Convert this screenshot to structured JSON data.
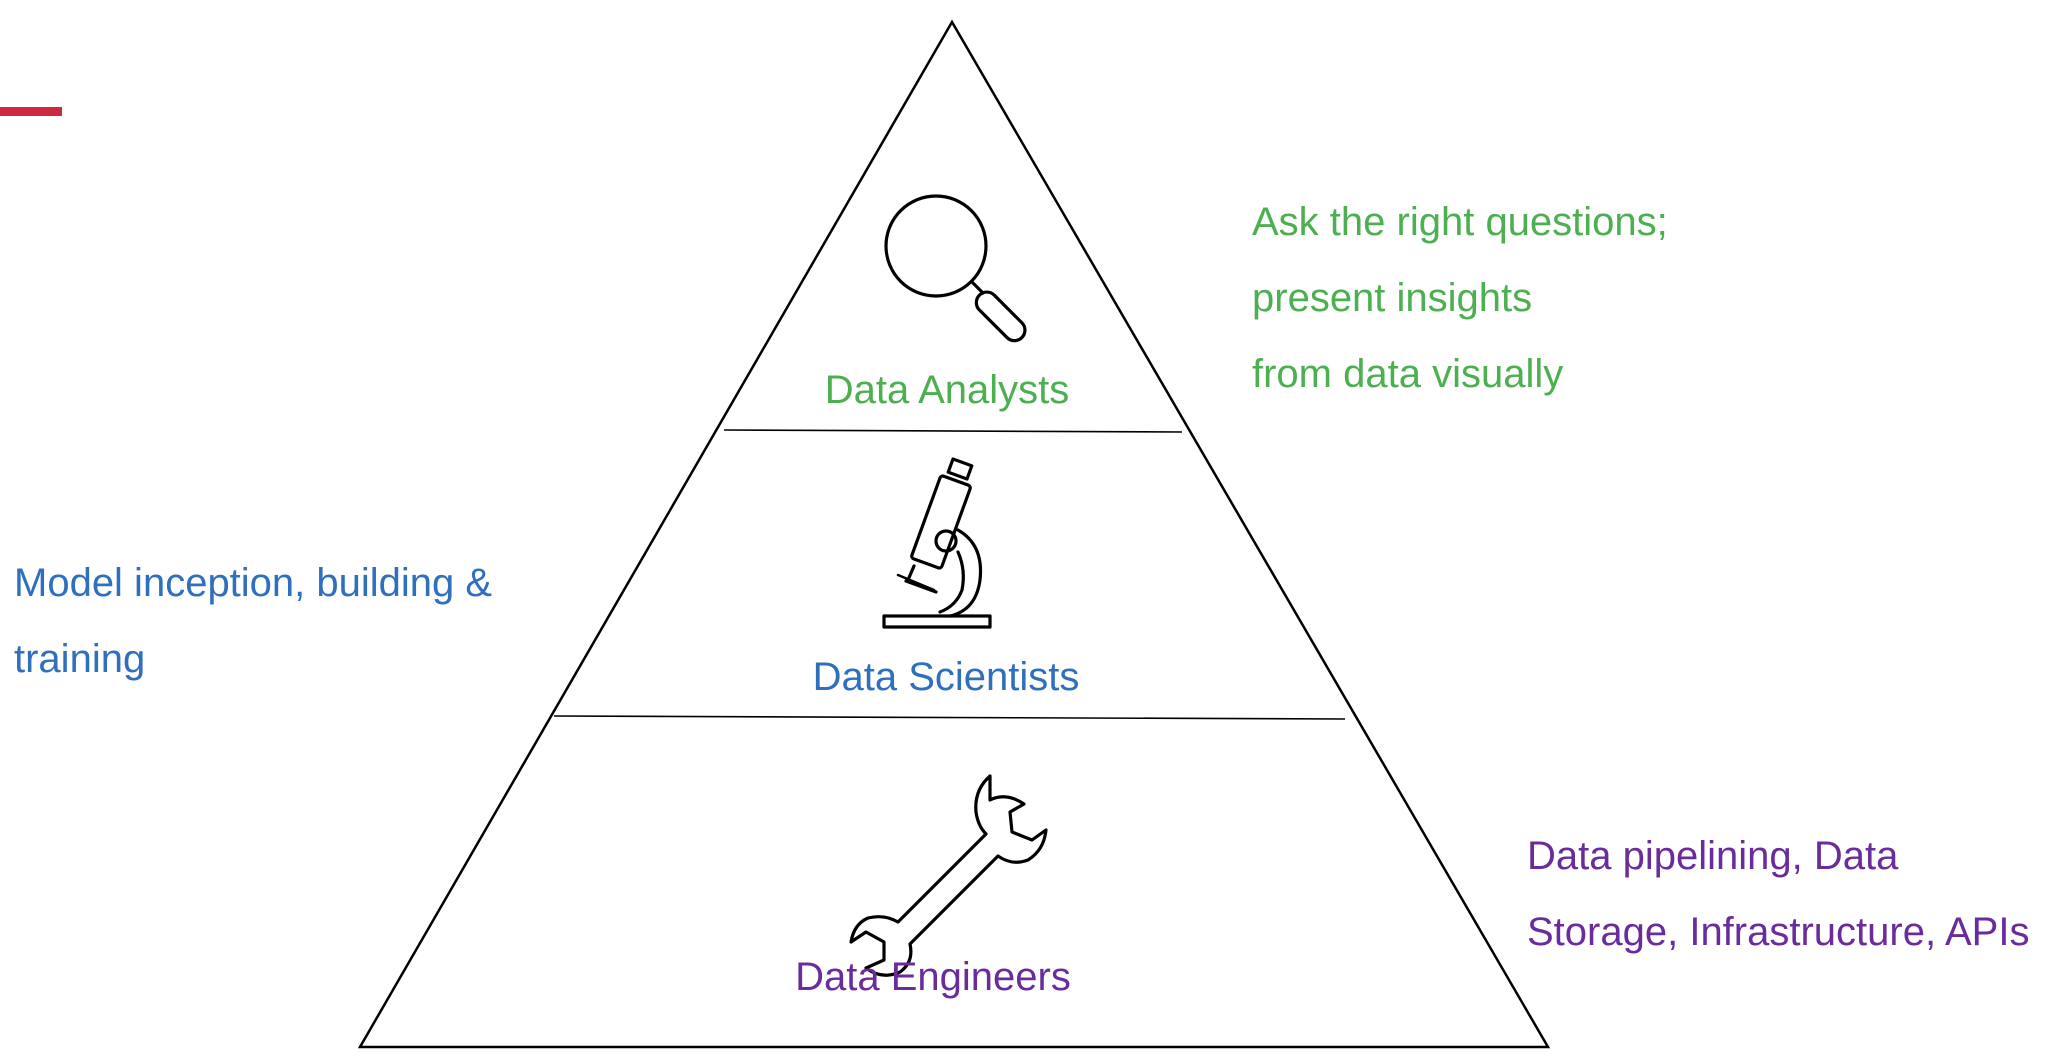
{
  "colors": {
    "accent_bar": "#d0293f",
    "analysts": "#4caf50",
    "scientists": "#2e6fbe",
    "engineers": "#6a2c9c",
    "outline": "#000000"
  },
  "pyramid": {
    "tiers": [
      {
        "label": "Data Analysts",
        "icon": "magnifying-glass-icon"
      },
      {
        "label": "Data Scientists",
        "icon": "microscope-icon"
      },
      {
        "label": "Data Engineers",
        "icon": "wrench-icon"
      }
    ]
  },
  "annotations": {
    "analysts": {
      "lines": [
        "Ask the right questions;",
        "present insights",
        "from data visually"
      ]
    },
    "scientists": {
      "lines": [
        "Model inception, building &",
        "training"
      ]
    },
    "engineers": {
      "lines": [
        "Data pipelining,  Data",
        "Storage, Infrastructure, APIs"
      ]
    }
  }
}
